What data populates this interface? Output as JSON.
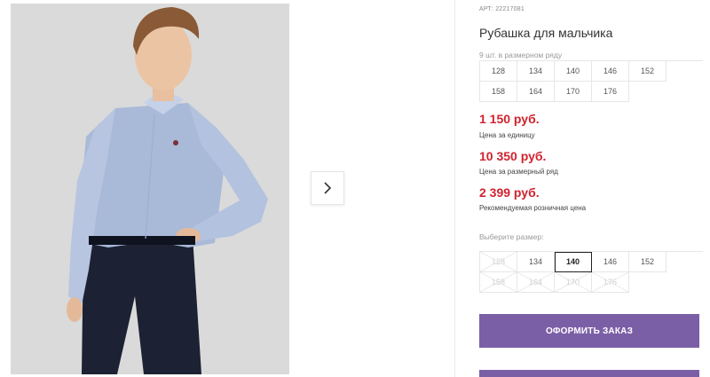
{
  "product": {
    "article": "АРТ: 22217081",
    "title": "Рубашка для мальчика"
  },
  "size_range": {
    "caption": "9 шт. в размерном ряду",
    "sizes": [
      "128",
      "134",
      "140",
      "146",
      "152",
      "158",
      "164",
      "170",
      "176"
    ]
  },
  "prices": [
    {
      "value": "1 150 руб.",
      "label": "Цена за единицу"
    },
    {
      "value": "10 350 руб.",
      "label": "Цена за размерный ряд"
    },
    {
      "value": "2 399 руб.",
      "label": "Рекомендуемая розничная цена"
    }
  ],
  "size_select": {
    "caption": "Выберите размер:",
    "options": [
      {
        "label": "128",
        "state": "disabled"
      },
      {
        "label": "134",
        "state": "available"
      },
      {
        "label": "140",
        "state": "selected"
      },
      {
        "label": "146",
        "state": "available"
      },
      {
        "label": "152",
        "state": "available"
      },
      {
        "label": "158",
        "state": "disabled"
      },
      {
        "label": "164",
        "state": "disabled"
      },
      {
        "label": "170",
        "state": "disabled"
      },
      {
        "label": "176",
        "state": "disabled"
      }
    ]
  },
  "actions": {
    "order_label": "ОФОРМИТЬ ЗАКАЗ"
  },
  "gallery": {
    "next_icon": "chevron-right-icon"
  },
  "colors": {
    "price": "#d0232f",
    "button": "#7b5fa6"
  }
}
